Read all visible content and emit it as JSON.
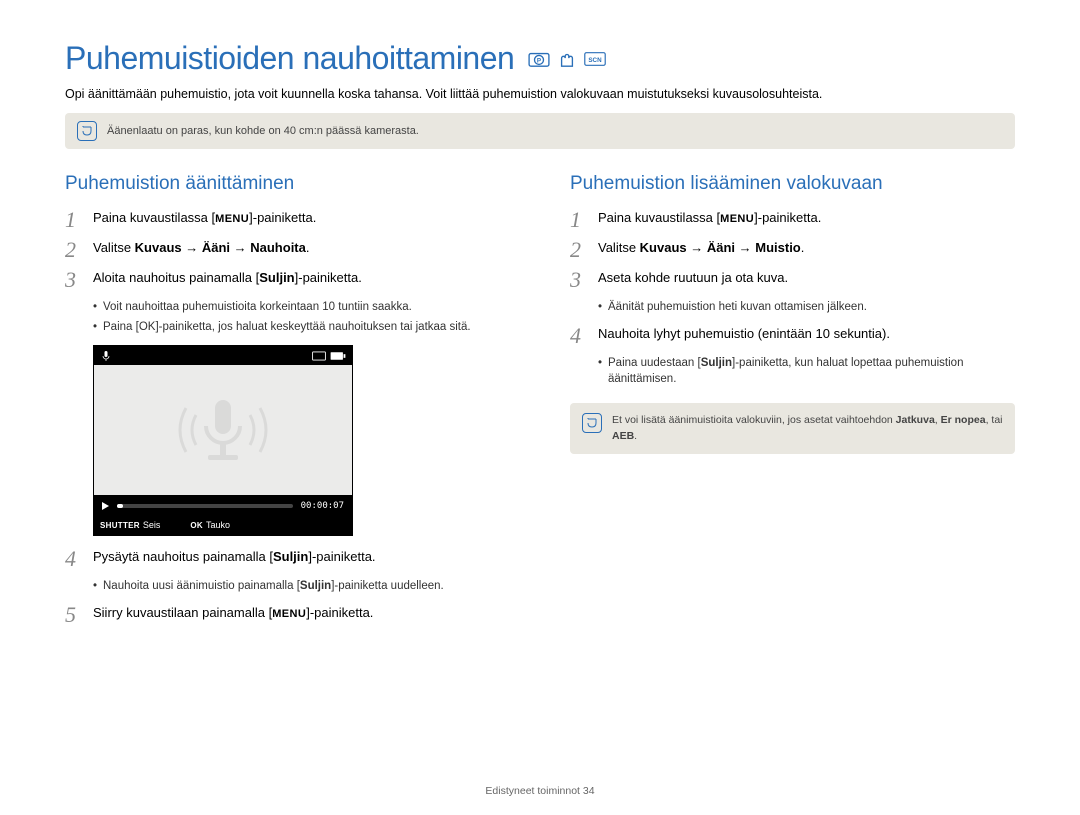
{
  "title": "Puhemuistioiden nauhoittaminen",
  "intro": "Opi äänittämään puhemuistio, jota voit kuunnella koska tahansa. Voit liittää puhemuistion valokuvaan muistutukseksi kuvausolosuhteista.",
  "top_note": "Äänenlaatu on paras, kun kohde on 40 cm:n päässä kamerasta.",
  "left": {
    "heading": "Puhemuistion äänittäminen",
    "step1_pre": "Paina kuvaustilassa [",
    "step1_label": "MENU",
    "step1_post": "]-painiketta.",
    "step2_pre": "Valitse ",
    "step2_bold": "Kuvaus → Ääni → Nauhoita",
    "step2_post": ".",
    "step3_pre": "Aloita nauhoitus painamalla [",
    "step3_bold": "Suljin",
    "step3_post": "]-painiketta.",
    "bul1": "Voit nauhoittaa puhemuistioita korkeintaan 10 tuntiin saakka.",
    "bul2_pre": "Paina [",
    "bul2_ok": "OK",
    "bul2_post": "]-painiketta, jos haluat keskeyttää nauhoituksen tai jatkaa sitä.",
    "screen": {
      "time": "00:00:07",
      "stop_label": "Seis",
      "pause_label": "Tauko",
      "shutter": "SHUTTER",
      "ok": "OK"
    },
    "step4_pre": "Pysäytä nauhoitus painamalla [",
    "step4_bold": "Suljin",
    "step4_post": "]-painiketta.",
    "bul3_pre": "Nauhoita uusi äänimuistio painamalla [",
    "bul3_bold": "Suljin",
    "bul3_post": "]-painiketta uudelleen.",
    "step5_pre": "Siirry kuvaustilaan painamalla [",
    "step5_label": "MENU",
    "step5_post": "]-painiketta."
  },
  "right": {
    "heading": "Puhemuistion lisääminen valokuvaan",
    "step1_pre": "Paina kuvaustilassa [",
    "step1_label": "MENU",
    "step1_post": "]-painiketta.",
    "step2_pre": "Valitse ",
    "step2_bold": "Kuvaus → Ääni → Muistio",
    "step2_post": ".",
    "step3": "Aseta kohde ruutuun ja ota kuva.",
    "bul1": "Äänität puhemuistion heti kuvan ottamisen jälkeen.",
    "step4": "Nauhoita lyhyt puhemuistio (enintään 10 sekuntia).",
    "bul2_pre": "Paina uudestaan [",
    "bul2_bold": "Suljin",
    "bul2_post": "]-painiketta, kun haluat lopettaa puhemuistion äänittämisen.",
    "note_pre": "Et voi lisätä äänimuistioita valokuviin, jos asetat vaihtoehdon ",
    "note_b1": "Jatkuva",
    "note_mid1": ", ",
    "note_b2": "Er nopea",
    "note_mid2": ", tai ",
    "note_b3": "AEB",
    "note_post": "."
  },
  "footer_pre": "Edistyneet toiminnot  ",
  "footer_num": "34"
}
